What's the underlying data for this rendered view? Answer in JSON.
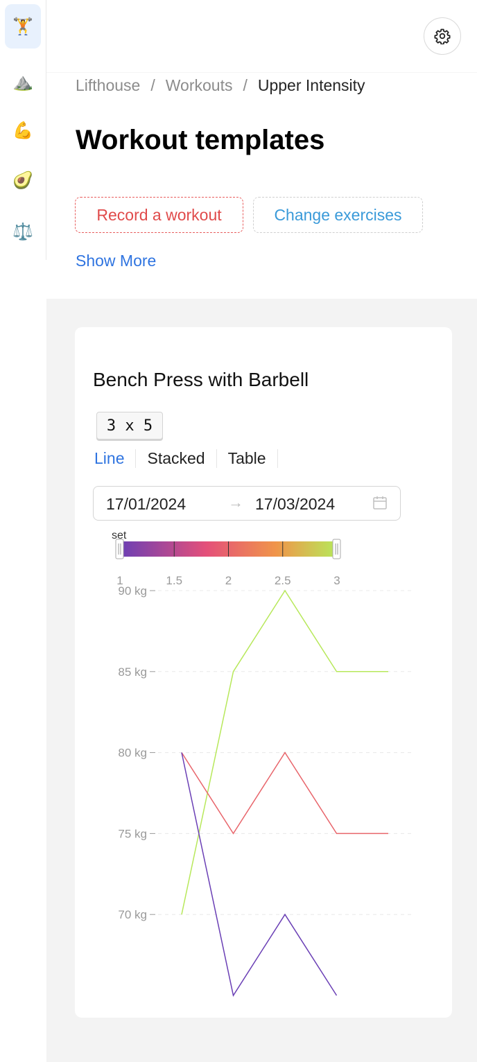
{
  "sidebar": {
    "items": [
      {
        "icon": "🏋️",
        "name": "weightlifter-icon"
      },
      {
        "icon": "⛰️",
        "name": "mountain-icon"
      },
      {
        "icon": "💪",
        "name": "flexed-biceps-icon"
      },
      {
        "icon": "🥑",
        "name": "avocado-icon"
      },
      {
        "icon": "⚖️",
        "name": "balance-scale-icon"
      }
    ]
  },
  "header": {
    "settings_icon": "gear-icon"
  },
  "breadcrumb": {
    "home": "Lifthouse",
    "section": "Workouts",
    "current": "Upper Intensity",
    "separator": "/"
  },
  "page": {
    "title": "Workout templates",
    "record_label": "Record a workout",
    "change_label": "Change exercises",
    "show_more": "Show More"
  },
  "exercise": {
    "title": "Bench Press with Barbell",
    "scheme": "3 x 5",
    "tabs": [
      "Line",
      "Stacked",
      "Table"
    ],
    "active_tab": "Line",
    "date_from": "17/01/2024",
    "date_to": "17/03/2024",
    "date_arrow": "→"
  },
  "colors": {
    "accent": "#2f74e0",
    "danger": "#e04b4b",
    "link": "#3a9ad9"
  },
  "chart_data": {
    "type": "line",
    "legend": {
      "type": "continuous-color",
      "title": "set",
      "range": [
        1,
        3
      ],
      "ticks": [
        "1",
        "1.5",
        "2",
        "2.5",
        "3"
      ],
      "colors": [
        "#6a3fb5",
        "#e4507a",
        "#f0954a",
        "#b7e85a"
      ]
    },
    "x": [
      1,
      2,
      3,
      4,
      5
    ],
    "yticks": [
      "90 kg",
      "85 kg",
      "80 kg",
      "75 kg",
      "70 kg"
    ],
    "ylim": [
      65,
      90
    ],
    "grid": true,
    "series": [
      {
        "set": 3,
        "color": "#b7e85a",
        "values": [
          70,
          85,
          90,
          85,
          85
        ]
      },
      {
        "set": 2,
        "color": "#e8646a",
        "values": [
          80,
          75,
          80,
          75,
          75
        ]
      },
      {
        "set": 1,
        "color": "#6a3fb5",
        "values": [
          80,
          65,
          70,
          65,
          null
        ]
      }
    ]
  }
}
